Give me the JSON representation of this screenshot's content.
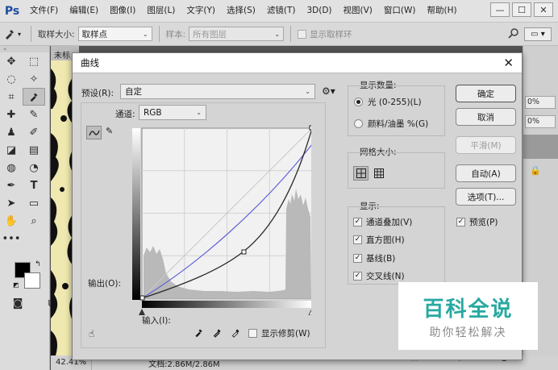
{
  "app": {
    "logo": "Ps",
    "menu": [
      "文件(F)",
      "编辑(E)",
      "图像(I)",
      "图层(L)",
      "文字(Y)",
      "选择(S)",
      "滤镜(T)",
      "3D(D)",
      "视图(V)",
      "窗口(W)",
      "帮助(H)"
    ],
    "win_controls": [
      "—",
      "☐",
      "✕"
    ]
  },
  "options_bar": {
    "sample_size_label": "取样大小:",
    "sample_size_value": "取样点",
    "sample_label": "样本:",
    "sample_value": "所有图层",
    "show_ring_label": "显示取样环"
  },
  "document": {
    "tab_label": "未标",
    "zoom": "42.41%",
    "doc_size": "文档:2.86M/2.86M"
  },
  "right_panel": {
    "field1": "0%",
    "field2": "0%"
  },
  "dialog": {
    "title": "曲线",
    "preset_label": "预设(R):",
    "preset_value": "自定",
    "channel_label": "通道:",
    "channel_value": "RGB",
    "output_label": "输出(O):",
    "input_label": "输入(I):",
    "show_clipping_label": "显示修剪(W)",
    "show_amount": {
      "title": "显示数量:",
      "light_label": "光 (0-255)(L)",
      "pigment_label": "颜料/油墨 %(G)"
    },
    "grid_size": {
      "title": "网格大小:"
    },
    "show": {
      "title": "显示:",
      "channel_overlay": "通道叠加(V)",
      "histogram": "直方图(H)",
      "baseline": "基线(B)",
      "intersection": "交叉线(N)"
    },
    "buttons": {
      "ok": "确定",
      "cancel": "取消",
      "smooth": "平滑(M)",
      "auto": "自动(A)",
      "options": "选项(T)..."
    },
    "preview_label": "预览(P)"
  },
  "watermark": {
    "title": "百科全说",
    "subtitle": "助你轻松解决"
  },
  "colors": {
    "accent_curve": "#6262d8",
    "watermark": "#27a9a1"
  }
}
